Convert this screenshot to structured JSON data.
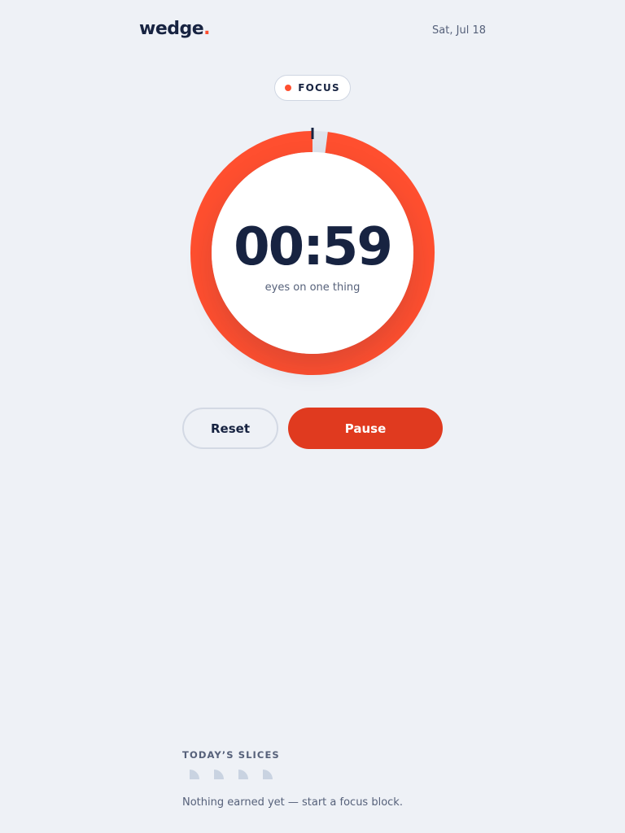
{
  "brand": {
    "name": "wedge",
    "dot": ".",
    "accent_color": "#ff4f2f"
  },
  "header": {
    "date": "Sat, Jul 18"
  },
  "mode": {
    "label": "FOCUS",
    "indicator_color": "#ff4f2f"
  },
  "timer": {
    "display": "00:59",
    "caption": "eyes on one thing",
    "remaining_fraction": 0.98,
    "ring_color": "#ff4f2f",
    "track_color": "#dfe4ec",
    "marker_color": "#172341"
  },
  "controls": {
    "reset_label": "Reset",
    "pause_label": "Pause",
    "pause_color": "#e03a1f"
  },
  "slices": {
    "heading": "TODAY’S SLICES",
    "empty_text": "Nothing earned yet — start a focus block.",
    "earned": 0,
    "slots": 4,
    "slot_color": "#c9d3e1"
  }
}
